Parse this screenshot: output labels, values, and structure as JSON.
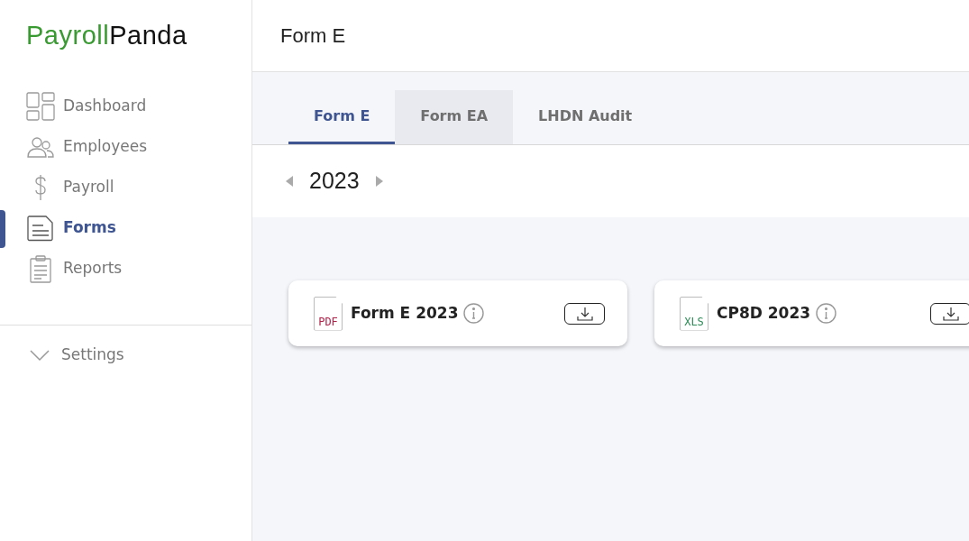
{
  "brand": {
    "first": "Payroll",
    "second": "Panda"
  },
  "nav": [
    {
      "label": "Dashboard",
      "kind": "dashboard",
      "selected": false
    },
    {
      "label": "Employees",
      "kind": "employees",
      "selected": false
    },
    {
      "label": "Payroll",
      "kind": "dollar",
      "selected": false
    },
    {
      "label": "Forms",
      "kind": "forms",
      "selected": true
    },
    {
      "label": "Reports",
      "kind": "reports",
      "selected": false
    }
  ],
  "settings": {
    "label": "Settings",
    "expanded": false
  },
  "page_title": "Form E",
  "tabs": [
    {
      "label": "Form E",
      "selected": true,
      "hovered": false
    },
    {
      "label": "Form EA",
      "selected": false,
      "hovered": true
    },
    {
      "label": "LHDN Audit",
      "selected": false,
      "hovered": false
    }
  ],
  "year": "2023",
  "files": [
    {
      "kind": "pdf",
      "badge": "PDF",
      "title": "Form E 2023"
    },
    {
      "kind": "xls",
      "badge": "XLS",
      "title": "CP8D 2023"
    }
  ]
}
